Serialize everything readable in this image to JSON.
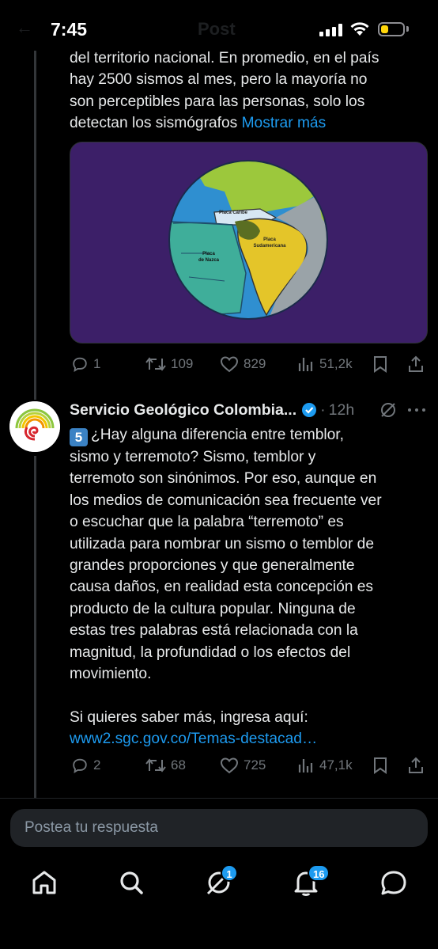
{
  "status_bar": {
    "time": "7:45",
    "ghost_title": "Post",
    "battery_level": 0.35,
    "battery_color": "#ffd60a"
  },
  "tweet1": {
    "text": "del territorio nacional. En promedio, en el país\nhay 2500 sismos al mes, pero la mayoría no\nson perceptibles para las personas, solo los\ndetectan los sismógrafos ",
    "show_more": "Mostrar más",
    "media": {
      "background": "#3c1f68",
      "labels": {
        "caribe": "Placa Caribe",
        "nazca_1": "Placa",
        "nazca_2": "de Nazca",
        "sudamericana_1": "Placa",
        "sudamericana_2": "Sudamericana"
      }
    },
    "stats": {
      "replies": "1",
      "reposts": "109",
      "likes": "829",
      "views": "51,2k"
    }
  },
  "tweet2": {
    "author": "Servicio Geológico Colombia...",
    "separator": "·",
    "time": "12h",
    "emoji_five": "5",
    "text": "¿Hay alguna diferencia entre temblor,\nsismo y terremoto? Sismo, temblor y\nterremoto son sinónimos. Por eso, aunque en\nlos medios de comunicación sea frecuente ver\no escuchar que la palabra “terremoto” es\nutilizada para nombrar un sismo o temblor de\ngrandes proporciones y que generalmente\ncausa daños, en realidad esta concepción es\nproducto de la cultura popular. Ninguna de\nestas tres palabras está relacionada con la\nmagnitud, la profundidad o los efectos del\nmovimiento.\n\nSi quieres saber más, ingresa aquí:\n",
    "link": "www2.sgc.gov.co/Temas-destacad…",
    "stats": {
      "replies": "2",
      "reposts": "68",
      "likes": "725",
      "views": "47,1k"
    }
  },
  "reply": {
    "placeholder": "Postea tu respuesta"
  },
  "tab_bar": {
    "items": [
      "home-icon",
      "search-icon",
      "grok-icon",
      "notifications-icon",
      "messages-icon"
    ],
    "grok_badge": "1",
    "notifications_badge": "16"
  },
  "colors": {
    "accent": "#1d9bf0",
    "muted": "#71767b",
    "text": "#e7e9ea"
  }
}
